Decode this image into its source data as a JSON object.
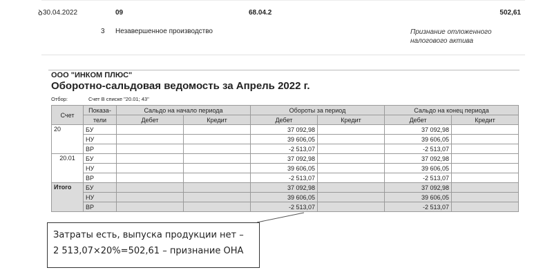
{
  "entry": {
    "date": "30.04.2022",
    "debit_account": "09",
    "credit_account": "68.04.2",
    "amount": "502,61",
    "row_number": "3",
    "subconto": "Незавершенное производство",
    "operation_line1": "Признание отложенного",
    "operation_line2": "налогового актива"
  },
  "report": {
    "org": "ООО \"ИНКОМ ПЛЮС\"",
    "title": "Оборотно-сальдовая ведомость за Апрель 2022 г.",
    "filter_label": "Отбор:",
    "filter_value": "Счет В списке \"20.01; 43\"",
    "headers": {
      "account": "Счет",
      "indicator_top": "Показа-",
      "indicator_bottom": "тели",
      "opening": "Сальдо на начало периода",
      "turnover": "Обороты за период",
      "closing": "Сальдо на конец периода",
      "debit": "Дебет",
      "credit": "Кредит"
    },
    "groups": [
      {
        "account": "20",
        "rows": [
          {
            "indicator": "БУ",
            "turnover_debit": "37 092,98",
            "closing_debit": "37 092,98"
          },
          {
            "indicator": "НУ",
            "turnover_debit": "39 606,05",
            "closing_debit": "39 606,05"
          },
          {
            "indicator": "ВР",
            "turnover_debit": "-2 513,07",
            "closing_debit": "-2 513,07"
          }
        ]
      },
      {
        "account": "20.01",
        "rows": [
          {
            "indicator": "БУ",
            "turnover_debit": "37 092,98",
            "closing_debit": "37 092,98"
          },
          {
            "indicator": "НУ",
            "turnover_debit": "39 606,05",
            "closing_debit": "39 606,05"
          },
          {
            "indicator": "ВР",
            "turnover_debit": "-2 513,07",
            "closing_debit": "-2 513,07"
          }
        ]
      },
      {
        "account": "Итого",
        "rows": [
          {
            "indicator": "БУ",
            "turnover_debit": "37 092,98",
            "closing_debit": "37 092,98"
          },
          {
            "indicator": "НУ",
            "turnover_debit": "39 606,05",
            "closing_debit": "39 606,05"
          },
          {
            "indicator": "ВР",
            "turnover_debit": "-2 513,07",
            "closing_debit": "-2 513,07"
          }
        ]
      }
    ]
  },
  "callout": {
    "line1": "Затраты есть, выпуска продукции нет –",
    "line2": "2 513,07×20%=502,61 – признание ОНА"
  }
}
